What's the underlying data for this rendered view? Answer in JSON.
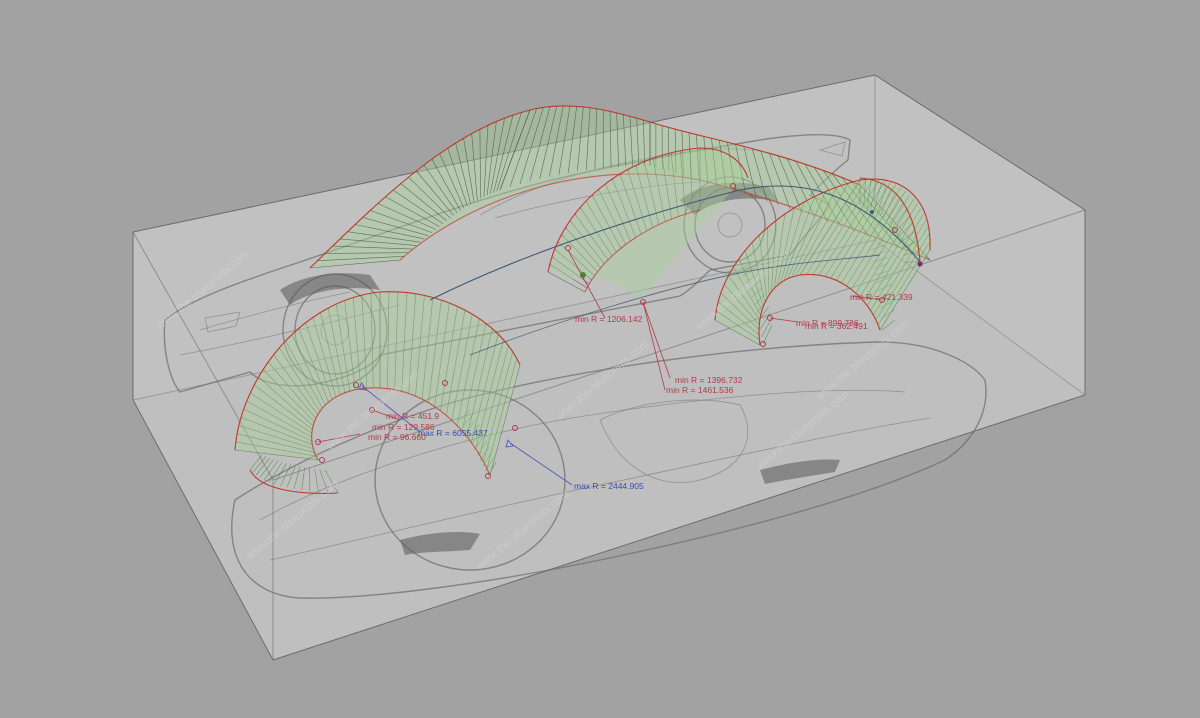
{
  "viewport": {
    "background": "#a2a2a2",
    "accent_curve": "#c0392b",
    "comb_fill": "#a8d19a",
    "min_label_color": "#b03a4a",
    "max_label_color": "#3a4ab0"
  },
  "annotations": {
    "min_r_center": "min R = 1206.142",
    "min_r_a": "min R = 1396.732",
    "min_r_b": "min R = 1461.536",
    "min_r_front1": "min R = 451.9",
    "min_r_front2": "min R = 96.660",
    "min_r_front3": "min R = 129.586",
    "max_r_front": "max R = 6055.437",
    "max_r_bottom": "max R = 2444.905",
    "min_r_rear1": "min R = 421.339",
    "min_r_rear2": "min R = 899.786",
    "min_r_rear3": "min R = 362.491"
  },
  "watermark": {
    "text": "www.the-blueprints.com"
  }
}
